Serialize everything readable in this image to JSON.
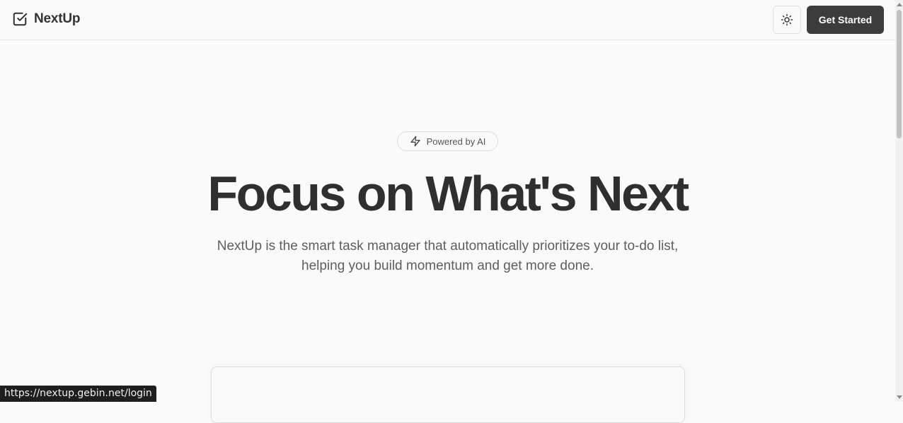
{
  "header": {
    "brand": "NextUp",
    "brand_icon": "square-check-icon",
    "theme_toggle_icon": "sun-icon",
    "cta_label": "Get Started"
  },
  "hero": {
    "badge_icon": "lightning-bolt-icon",
    "badge_label": "Powered by AI",
    "title": "Focus on What's Next",
    "subtitle": "NextUp is the smart task manager that automatically prioritizes your to-do list, helping you build momentum and get more done."
  },
  "status_bar": {
    "url": "https://nextup.gebin.net/login"
  },
  "colors": {
    "background": "#fafafa",
    "primary_button": "#3c3c3c",
    "text": "#2f2f2f",
    "muted_text": "#5e5e5e"
  }
}
